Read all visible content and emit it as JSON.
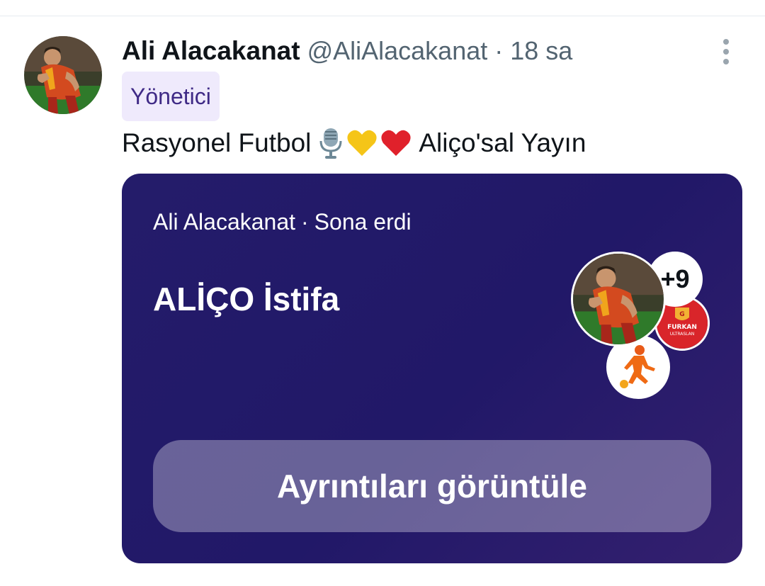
{
  "tweet": {
    "author": {
      "display_name": "Ali Alacakanat",
      "handle": "@AliAlacakanat",
      "separator": "·",
      "time": "18 sa",
      "role_badge": "Yönetici"
    },
    "text_before": "Rasyonel Futbol",
    "emojis": [
      "microphone-emoji",
      "yellow-heart-emoji",
      "red-heart-emoji"
    ],
    "text_after": "Aliço'sal Yayın"
  },
  "space_card": {
    "host": "Ali Alacakanat",
    "separator": "·",
    "status": "Sona erdi",
    "title": "ALİÇO İstifa",
    "listener_count": "+9",
    "details_button": "Ayrıntıları görüntüle",
    "gradient": [
      "#241c6a",
      "#34206f"
    ]
  },
  "avatar_furkan": {
    "label_1": "FURKAN",
    "label_2": "ULTRASLAN"
  },
  "colors": {
    "name": "#0f1419",
    "secondary": "#536471",
    "badge_bg": "#efeafc",
    "badge_text": "#3f2a86",
    "card_bg": "#211868"
  }
}
